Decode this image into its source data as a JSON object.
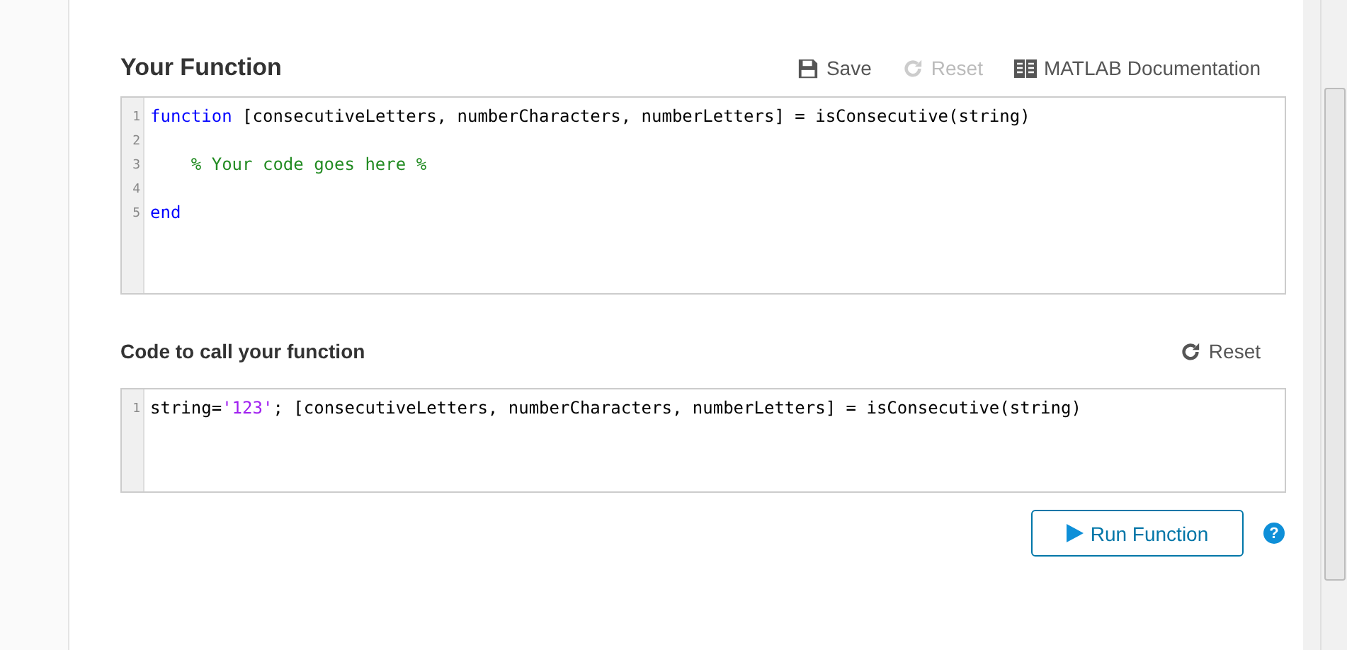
{
  "function_section": {
    "title": "Your Function",
    "actions": [
      {
        "kind": "save",
        "label": "Save",
        "disabled": false
      },
      {
        "kind": "reset",
        "label": "Reset",
        "disabled": true
      },
      {
        "kind": "docs",
        "label": "MATLAB Documentation",
        "disabled": false
      }
    ],
    "editor": {
      "lines": [
        {
          "number": "1",
          "indented": false,
          "tokens": [
            {
              "kind": "keyword",
              "text": "function"
            },
            {
              "kind": "plain",
              "text": " [consecutiveLetters, numberCharacters, numberLetters] = isConsecutive(string)"
            }
          ]
        },
        {
          "number": "2"
        },
        {
          "number": "3",
          "indented": true,
          "tokens": [
            {
              "kind": "comment",
              "text": "% Your code goes here %"
            }
          ]
        },
        {
          "number": "4"
        },
        {
          "number": "5",
          "indented": false,
          "tokens": [
            {
              "kind": "keyword",
              "text": "end"
            }
          ]
        }
      ]
    }
  },
  "call_section": {
    "title": "Code to call your function",
    "actions": [
      {
        "kind": "reset",
        "label": "Reset",
        "disabled": false
      }
    ],
    "editor": {
      "lines": [
        {
          "number": "1",
          "indented": false,
          "tokens": [
            {
              "kind": "plain",
              "text": "string="
            },
            {
              "kind": "string",
              "text": "'123'"
            },
            {
              "kind": "plain",
              "text": "; [consecutiveLetters, numberCharacters, numberLetters] = isConsecutive(string)"
            }
          ]
        }
      ]
    }
  },
  "run_button": {
    "label": "Run Function"
  },
  "help": {
    "label": "?"
  }
}
